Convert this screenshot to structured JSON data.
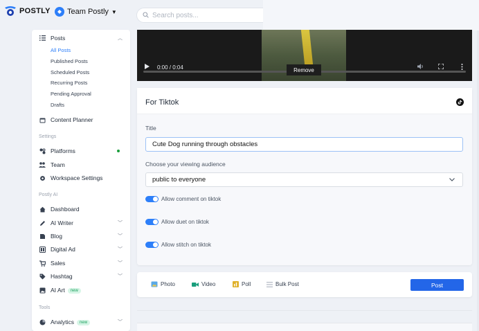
{
  "app": {
    "logo_text": "POSTLY",
    "team_label": "Team Postly"
  },
  "search": {
    "placeholder": "Search posts..."
  },
  "sidebar": {
    "posts_label": "Posts",
    "sub_items": [
      "All Posts",
      "Published Posts",
      "Scheduled Posts",
      "Recurring Posts",
      "Pending Approval",
      "Drafts"
    ],
    "content_planner": "Content Planner",
    "settings_head": "Settings",
    "platforms": "Platforms",
    "team": "Team",
    "workspace_settings": "Workspace Settings",
    "postly_ai_head": "Postly AI",
    "dashboard": "Dashboard",
    "ai_writer": "AI Writer",
    "blog": "Blog",
    "digital_ad": "Digital Ad",
    "sales": "Sales",
    "hashtag": "Hashtag",
    "ai_art": "AI Art",
    "new_badge": "new",
    "tools_head": "Tools",
    "analytics": "Analytics"
  },
  "video": {
    "time": "0:00 / 0:04",
    "remove_label": "Remove"
  },
  "tiktok_card": {
    "title": "For Tiktok",
    "title_label": "Title",
    "title_value": "Cute Dog running through obstacles",
    "audience_label": "Choose your viewing audience",
    "audience_value": "public to everyone",
    "toggles": [
      "Allow comment on tiktok",
      "Allow duet on tiktok",
      "Allow stitch on tiktok"
    ]
  },
  "actions": {
    "photo": "Photo",
    "video": "Video",
    "poll": "Poll",
    "bulk_post": "Bulk Post",
    "post": "Post"
  },
  "colors": {
    "accent": "#2d7ff9",
    "post_button": "#2366e8",
    "new_badge_bg": "#d6f5e6",
    "online_dot": "#1a9e3c"
  }
}
